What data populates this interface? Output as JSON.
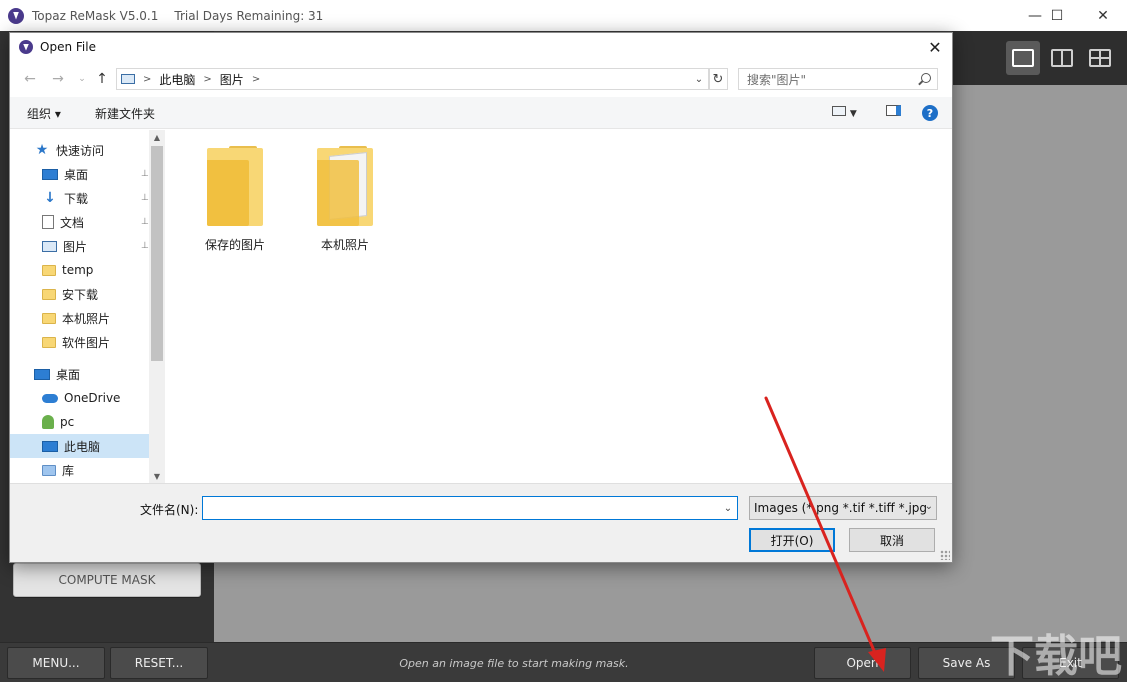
{
  "app": {
    "title": "Topaz ReMask V5.0.1",
    "trial": "Trial Days Remaining: 31",
    "window_controls": {
      "minimize": "—",
      "maximize": "☐",
      "close": "✕"
    }
  },
  "left_panel": {
    "compute_mask": "COMPUTE MASK"
  },
  "bottom_bar": {
    "menu": "MENU...",
    "reset": "RESET...",
    "status": "Open an image file to start making mask.",
    "open": "Open",
    "save_as": "Save As",
    "exit": "Exit"
  },
  "dialog": {
    "title": "Open File",
    "close": "✕",
    "address": {
      "crumbs": [
        "此电脑",
        "图片"
      ]
    },
    "search_placeholder": "搜索\"图片\"",
    "toolbar": {
      "organize": "组织 ▾",
      "new_folder": "新建文件夹"
    },
    "tree": [
      {
        "label": "快速访问",
        "icon": "star-icon",
        "indent": 1,
        "pinned": false
      },
      {
        "label": "桌面",
        "icon": "desktop-icon",
        "indent": 2,
        "pinned": true
      },
      {
        "label": "下载",
        "icon": "download-icon",
        "indent": 2,
        "pinned": true
      },
      {
        "label": "文档",
        "icon": "document-icon",
        "indent": 2,
        "pinned": true
      },
      {
        "label": "图片",
        "icon": "pictures-icon",
        "indent": 2,
        "pinned": true
      },
      {
        "label": "temp",
        "icon": "folder-icon",
        "indent": 2,
        "pinned": false
      },
      {
        "label": "安下载",
        "icon": "folder-icon",
        "indent": 2,
        "pinned": false
      },
      {
        "label": "本机照片",
        "icon": "folder-icon",
        "indent": 2,
        "pinned": false
      },
      {
        "label": "软件图片",
        "icon": "folder-icon",
        "indent": 2,
        "pinned": false
      },
      {
        "label": "桌面",
        "icon": "desktop-icon",
        "indent": 1,
        "pinned": false
      },
      {
        "label": "OneDrive",
        "icon": "onedrive-icon",
        "indent": 2,
        "pinned": false
      },
      {
        "label": "pc",
        "icon": "user-icon",
        "indent": 2,
        "pinned": false
      },
      {
        "label": "此电脑",
        "icon": "computer-icon",
        "indent": 2,
        "pinned": false,
        "selected": true
      },
      {
        "label": "库",
        "icon": "library-icon",
        "indent": 2,
        "pinned": false
      }
    ],
    "folders": [
      {
        "label": "保存的图片"
      },
      {
        "label": "本机照片"
      }
    ],
    "filename_label": "文件名(N):",
    "filename_value": "",
    "filter": "Images (*.png *.tif *.tiff *.jpg",
    "open_button": "打开(O)",
    "cancel_button": "取消"
  },
  "watermark": {
    "text": "下载吧"
  },
  "colors": {
    "accent": "#0078d7",
    "arrow": "#d9231f",
    "logo": "#4a3a8c"
  }
}
